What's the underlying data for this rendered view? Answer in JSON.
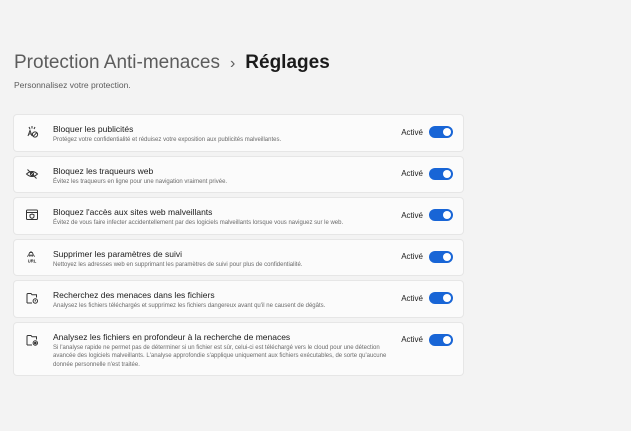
{
  "header": {
    "parent": "Protection Anti-menaces",
    "separator": "›",
    "current": "Réglages",
    "subtitle": "Personnalisez votre protection."
  },
  "settings": [
    {
      "title": "Bloquer les publicités",
      "description": "Protégez votre confidentialité et réduisez votre exposition aux publicités malveillantes.",
      "status": "Activé",
      "enabled": true,
      "icon": "ad-block-icon"
    },
    {
      "title": "Bloquez les traqueurs web",
      "description": "Évitez les traqueurs en ligne pour une navigation vraiment privée.",
      "status": "Activé",
      "enabled": true,
      "icon": "eye-off-icon"
    },
    {
      "title": "Bloquez l'accès aux sites web malveillants",
      "description": "Évitez de vous faire infecter accidentellement par des logiciels malveillants lorsque vous naviguez sur le web.",
      "status": "Activé",
      "enabled": true,
      "icon": "browser-shield-icon"
    },
    {
      "title": "Supprimer les paramètres de suivi",
      "description": "Nettoyez les adresses web en supprimant les paramètres de suivi pour plus de confidentialité.",
      "status": "Activé",
      "enabled": true,
      "icon": "url-clean-icon",
      "icon_text": "URL"
    },
    {
      "title": "Recherchez des menaces dans les fichiers",
      "description": "Analysez les fichiers téléchargés et supprimez les fichiers dangereux avant qu'il ne causent de dégâts.",
      "status": "Activé",
      "enabled": true,
      "icon": "file-scan-icon"
    },
    {
      "title": "Analysez les fichiers en profondeur à la recherche de menaces",
      "description": "Si l'analyse rapide ne permet pas de déterminer si un fichier est sûr, celui-ci est téléchargé vers le cloud pour une détection avancée des logiciels malveillants. L'analyse approfondie s'applique uniquement aux fichiers exécutables, de sorte qu'aucune donnée personnelle n'est traitée.",
      "status": "Activé",
      "enabled": true,
      "icon": "file-deep-scan-icon"
    }
  ],
  "colors": {
    "accent": "#1865d6",
    "background": "#f3f3f3",
    "card": "#fbfbfb"
  }
}
